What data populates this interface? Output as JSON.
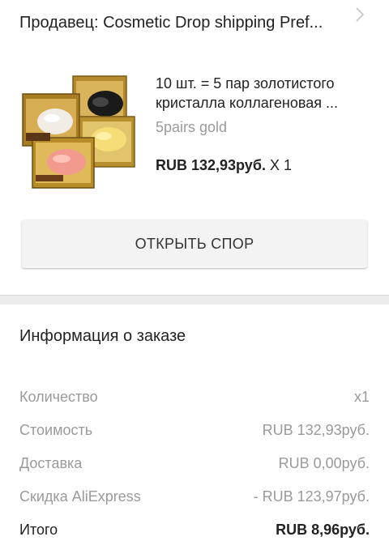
{
  "seller": {
    "label": "Продавец: Cosmetic Drop shipping Pref...",
    "icon": "chevron-right-icon"
  },
  "product": {
    "title": "10 шт. = 5 пар золотистого кристалла коллагеновая ...",
    "variant": "5pairs gold",
    "price": "RUB 132,93руб.",
    "quantity": "X 1"
  },
  "dispute_button": {
    "label": "ОТКРЫТЬ СПОР"
  },
  "order_info": {
    "title": "Информация о заказе",
    "rows": [
      {
        "label": "Количество",
        "value": "x1"
      },
      {
        "label": "Стоимость",
        "value": "RUB 132,93руб."
      },
      {
        "label": "Доставка",
        "value": "RUB 0,00руб."
      },
      {
        "label": "Скидка AliExpress",
        "value": "- RUB 123,97руб."
      }
    ],
    "total": {
      "label": "Итого",
      "value": "RUB 8,96руб."
    }
  },
  "colors": {
    "gold": "#c9a040",
    "button_bg": "#f3f3f3",
    "muted_text": "#9a9a9a"
  }
}
